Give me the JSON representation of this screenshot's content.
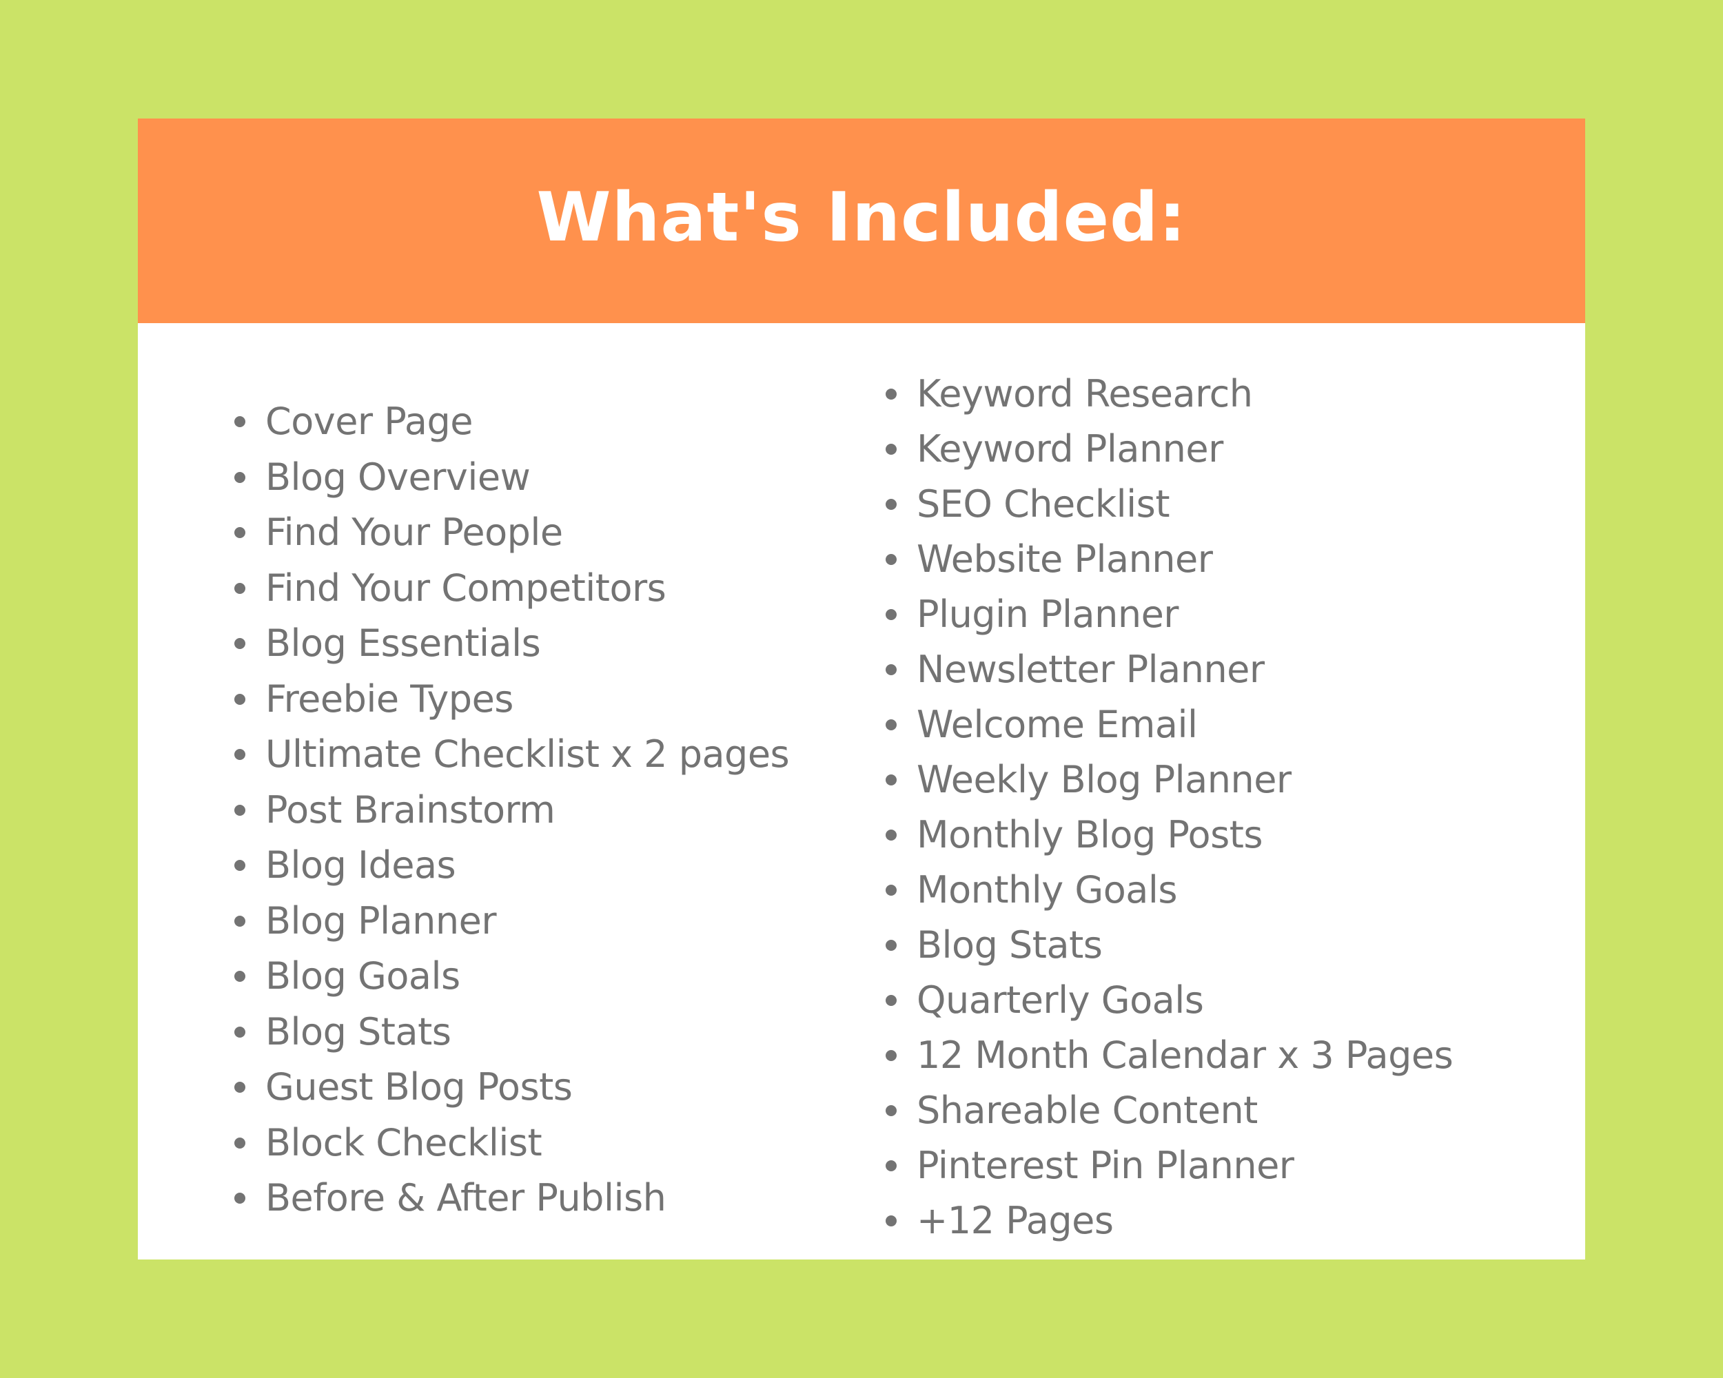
{
  "colors": {
    "background": "#cbe367",
    "header": "#ff914d",
    "card": "#ffffff",
    "text": "#737373",
    "title": "#ffffff"
  },
  "header": {
    "title": "What's Included:"
  },
  "lists": {
    "left": [
      "Cover Page",
      "Blog Overview",
      "Find Your People",
      "Find Your Competitors",
      "Blog Essentials",
      "Freebie Types",
      "Ultimate Checklist x 2 pages",
      "Post Brainstorm",
      "Blog Ideas",
      "Blog Planner",
      "Blog Goals",
      "Blog Stats",
      "Guest Blog Posts",
      "Block Checklist",
      "Before & After Publish"
    ],
    "right": [
      "Keyword Research",
      "Keyword Planner",
      "SEO Checklist",
      "Website Planner",
      "Plugin Planner",
      "Newsletter Planner",
      "Welcome Email",
      "Weekly Blog Planner",
      "Monthly Blog Posts",
      "Monthly Goals",
      "Blog Stats",
      "Quarterly Goals",
      "12 Month Calendar x 3 Pages",
      "Shareable Content",
      "Pinterest Pin Planner",
      "+12 Pages"
    ]
  }
}
